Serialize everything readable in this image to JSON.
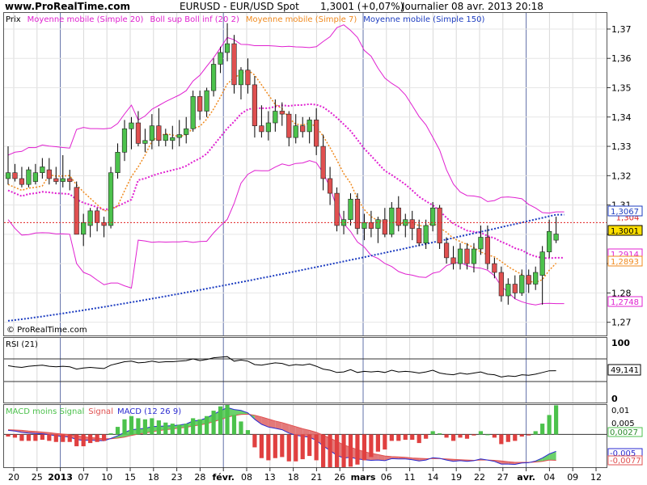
{
  "header": {
    "site": "www.ProRealTime.com",
    "instrument": "EURUSD - EUR/USD Spot",
    "last_change": "1,3001 (+0,07%)",
    "period_date": "Journalier  08 avr. 2013 20:18",
    "watermark": "© ProRealTime.com"
  },
  "colors": {
    "up": "#4cc24c",
    "down": "#e05050",
    "wick": "#000000",
    "ma20": "#e020d0",
    "boll": "#e020d0",
    "ma7": "#f08a1e",
    "ma150": "#1c3cc0",
    "price_line": "#e02020",
    "rsi": "#000000",
    "macd": "#2a2ad0",
    "signal": "#e05050",
    "hist_up": "#4cc24c",
    "hist_down": "#e04040"
  },
  "chart_data": [
    {
      "type": "candlestick",
      "title": "Prix",
      "legend": [
        {
          "label": "Prix",
          "color": "#000000"
        },
        {
          "label": "Moyenne mobile (Simple 20)",
          "color": "#e020d0"
        },
        {
          "label": "Boll sup Boll inf (20 2)",
          "color": "#e020d0"
        },
        {
          "label": "Moyenne mobile (Simple 7)",
          "color": "#f08a1e"
        },
        {
          "label": "Moyenne mobile (Simple 150)",
          "color": "#1c3cc0"
        }
      ],
      "ylim": [
        1.2655,
        1.3755
      ],
      "y_ticks": [
        1.27,
        1.28,
        1.29,
        1.3,
        1.31,
        1.32,
        1.33,
        1.34,
        1.35,
        1.36,
        1.37
      ],
      "y_tick_labels": [
        "1,27",
        "1,28",
        "",
        "",
        "1,31",
        "1,32",
        "1,33",
        "1,34",
        "1,35",
        "1,36",
        "1,37"
      ],
      "x_ticks": [
        "20",
        "25",
        "2013",
        "07",
        "10",
        "15",
        "18",
        "23",
        "28",
        "févr.",
        "08",
        "13",
        "18",
        "21",
        "26",
        "mars",
        "06",
        "11",
        "14",
        "19",
        "22",
        "27",
        "avr.",
        "04",
        "09",
        "12"
      ],
      "x_month_separators": [
        "2013",
        "févr.",
        "mars",
        "avr."
      ],
      "price_line": {
        "value": 1.304,
        "label": "1,304"
      },
      "value_labels": [
        {
          "label": "1,3067",
          "value": 1.3067,
          "series": "ma150"
        },
        {
          "label": "1,3001",
          "value": 1.3001,
          "series": "price"
        },
        {
          "label": "1,2914",
          "value": 1.2914,
          "series": "ma20"
        },
        {
          "label": "1,2893",
          "value": 1.2893,
          "series": "ma7"
        },
        {
          "label": "1,2748",
          "value": 1.2748,
          "series": "boll_inf"
        }
      ],
      "candles": [
        {
          "o": 1.319,
          "h": 1.33,
          "l": 1.317,
          "c": 1.321
        },
        {
          "o": 1.321,
          "h": 1.324,
          "l": 1.318,
          "c": 1.319
        },
        {
          "o": 1.319,
          "h": 1.323,
          "l": 1.316,
          "c": 1.317
        },
        {
          "o": 1.317,
          "h": 1.323,
          "l": 1.316,
          "c": 1.322
        },
        {
          "o": 1.318,
          "h": 1.324,
          "l": 1.317,
          "c": 1.321
        },
        {
          "o": 1.321,
          "h": 1.326,
          "l": 1.319,
          "c": 1.323
        },
        {
          "o": 1.322,
          "h": 1.326,
          "l": 1.317,
          "c": 1.319
        },
        {
          "o": 1.319,
          "h": 1.323,
          "l": 1.317,
          "c": 1.318
        },
        {
          "o": 1.318,
          "h": 1.327,
          "l": 1.316,
          "c": 1.319
        },
        {
          "o": 1.319,
          "h": 1.322,
          "l": 1.315,
          "c": 1.318
        },
        {
          "o": 1.316,
          "h": 1.318,
          "l": 1.302,
          "c": 1.3
        },
        {
          "o": 1.3,
          "h": 1.307,
          "l": 1.296,
          "c": 1.304
        },
        {
          "o": 1.303,
          "h": 1.309,
          "l": 1.299,
          "c": 1.308
        },
        {
          "o": 1.308,
          "h": 1.309,
          "l": 1.301,
          "c": 1.304
        },
        {
          "o": 1.304,
          "h": 1.306,
          "l": 1.299,
          "c": 1.303
        },
        {
          "o": 1.303,
          "h": 1.323,
          "l": 1.302,
          "c": 1.321
        },
        {
          "o": 1.321,
          "h": 1.331,
          "l": 1.319,
          "c": 1.328
        },
        {
          "o": 1.328,
          "h": 1.339,
          "l": 1.325,
          "c": 1.336
        },
        {
          "o": 1.336,
          "h": 1.34,
          "l": 1.329,
          "c": 1.338
        },
        {
          "o": 1.338,
          "h": 1.342,
          "l": 1.33,
          "c": 1.331
        },
        {
          "o": 1.331,
          "h": 1.336,
          "l": 1.328,
          "c": 1.332
        },
        {
          "o": 1.332,
          "h": 1.341,
          "l": 1.329,
          "c": 1.337
        },
        {
          "o": 1.337,
          "h": 1.343,
          "l": 1.33,
          "c": 1.332
        },
        {
          "o": 1.332,
          "h": 1.336,
          "l": 1.33,
          "c": 1.334
        },
        {
          "o": 1.332,
          "h": 1.337,
          "l": 1.329,
          "c": 1.333
        },
        {
          "o": 1.333,
          "h": 1.339,
          "l": 1.33,
          "c": 1.334
        },
        {
          "o": 1.334,
          "h": 1.34,
          "l": 1.331,
          "c": 1.336
        },
        {
          "o": 1.336,
          "h": 1.349,
          "l": 1.335,
          "c": 1.347
        },
        {
          "o": 1.347,
          "h": 1.349,
          "l": 1.339,
          "c": 1.342
        },
        {
          "o": 1.342,
          "h": 1.35,
          "l": 1.34,
          "c": 1.349
        },
        {
          "o": 1.349,
          "h": 1.36,
          "l": 1.347,
          "c": 1.358
        },
        {
          "o": 1.358,
          "h": 1.364,
          "l": 1.355,
          "c": 1.362
        },
        {
          "o": 1.362,
          "h": 1.372,
          "l": 1.359,
          "c": 1.365
        },
        {
          "o": 1.365,
          "h": 1.368,
          "l": 1.348,
          "c": 1.351
        },
        {
          "o": 1.351,
          "h": 1.357,
          "l": 1.346,
          "c": 1.356
        },
        {
          "o": 1.356,
          "h": 1.36,
          "l": 1.348,
          "c": 1.351
        },
        {
          "o": 1.351,
          "h": 1.354,
          "l": 1.333,
          "c": 1.337
        },
        {
          "o": 1.337,
          "h": 1.344,
          "l": 1.333,
          "c": 1.335
        },
        {
          "o": 1.335,
          "h": 1.342,
          "l": 1.332,
          "c": 1.338
        },
        {
          "o": 1.338,
          "h": 1.346,
          "l": 1.335,
          "c": 1.342
        },
        {
          "o": 1.342,
          "h": 1.345,
          "l": 1.337,
          "c": 1.341
        },
        {
          "o": 1.341,
          "h": 1.342,
          "l": 1.33,
          "c": 1.333
        },
        {
          "o": 1.333,
          "h": 1.341,
          "l": 1.331,
          "c": 1.337
        },
        {
          "o": 1.337,
          "h": 1.34,
          "l": 1.333,
          "c": 1.335
        },
        {
          "o": 1.335,
          "h": 1.34,
          "l": 1.331,
          "c": 1.339
        },
        {
          "o": 1.339,
          "h": 1.343,
          "l": 1.327,
          "c": 1.33
        },
        {
          "o": 1.33,
          "h": 1.334,
          "l": 1.315,
          "c": 1.319
        },
        {
          "o": 1.319,
          "h": 1.323,
          "l": 1.31,
          "c": 1.314
        },
        {
          "o": 1.314,
          "h": 1.316,
          "l": 1.301,
          "c": 1.303
        },
        {
          "o": 1.303,
          "h": 1.308,
          "l": 1.3,
          "c": 1.305
        },
        {
          "o": 1.305,
          "h": 1.314,
          "l": 1.303,
          "c": 1.312
        },
        {
          "o": 1.312,
          "h": 1.314,
          "l": 1.3,
          "c": 1.302
        },
        {
          "o": 1.302,
          "h": 1.307,
          "l": 1.298,
          "c": 1.304
        },
        {
          "o": 1.304,
          "h": 1.308,
          "l": 1.299,
          "c": 1.302
        },
        {
          "o": 1.302,
          "h": 1.306,
          "l": 1.297,
          "c": 1.305
        },
        {
          "o": 1.305,
          "h": 1.309,
          "l": 1.299,
          "c": 1.3
        },
        {
          "o": 1.3,
          "h": 1.311,
          "l": 1.299,
          "c": 1.309
        },
        {
          "o": 1.309,
          "h": 1.313,
          "l": 1.301,
          "c": 1.303
        },
        {
          "o": 1.303,
          "h": 1.307,
          "l": 1.299,
          "c": 1.305
        },
        {
          "o": 1.305,
          "h": 1.308,
          "l": 1.298,
          "c": 1.302
        },
        {
          "o": 1.302,
          "h": 1.305,
          "l": 1.296,
          "c": 1.297
        },
        {
          "o": 1.297,
          "h": 1.305,
          "l": 1.295,
          "c": 1.303
        },
        {
          "o": 1.303,
          "h": 1.311,
          "l": 1.301,
          "c": 1.309
        },
        {
          "o": 1.309,
          "h": 1.31,
          "l": 1.295,
          "c": 1.297
        },
        {
          "o": 1.297,
          "h": 1.299,
          "l": 1.29,
          "c": 1.292
        },
        {
          "o": 1.292,
          "h": 1.296,
          "l": 1.288,
          "c": 1.29
        },
        {
          "o": 1.29,
          "h": 1.297,
          "l": 1.288,
          "c": 1.295
        },
        {
          "o": 1.295,
          "h": 1.297,
          "l": 1.288,
          "c": 1.29
        },
        {
          "o": 1.29,
          "h": 1.297,
          "l": 1.287,
          "c": 1.295
        },
        {
          "o": 1.295,
          "h": 1.303,
          "l": 1.293,
          "c": 1.299
        },
        {
          "o": 1.299,
          "h": 1.303,
          "l": 1.288,
          "c": 1.29
        },
        {
          "o": 1.29,
          "h": 1.292,
          "l": 1.285,
          "c": 1.287
        },
        {
          "o": 1.287,
          "h": 1.289,
          "l": 1.277,
          "c": 1.279
        },
        {
          "o": 1.279,
          "h": 1.285,
          "l": 1.276,
          "c": 1.283
        },
        {
          "o": 1.283,
          "h": 1.286,
          "l": 1.278,
          "c": 1.28
        },
        {
          "o": 1.28,
          "h": 1.288,
          "l": 1.279,
          "c": 1.286
        },
        {
          "o": 1.286,
          "h": 1.288,
          "l": 1.28,
          "c": 1.283
        },
        {
          "o": 1.283,
          "h": 1.289,
          "l": 1.281,
          "c": 1.287
        },
        {
          "o": 1.286,
          "h": 1.296,
          "l": 1.276,
          "c": 1.294
        },
        {
          "o": 1.294,
          "h": 1.305,
          "l": 1.292,
          "c": 1.301
        },
        {
          "o": 1.298,
          "h": 1.306,
          "l": 1.297,
          "c": 1.3001
        }
      ],
      "ma20_tail": [
        1.2972,
        1.2955,
        1.294,
        1.2925,
        1.2918,
        1.2914
      ],
      "ma150_start": 1.2705,
      "ma150_end": 1.3067
    },
    {
      "type": "line",
      "title": "RSI (21)",
      "ylim": [
        0,
        100
      ],
      "y_ticks": [
        0,
        100
      ],
      "y_tick_labels": [
        "0",
        "100"
      ],
      "reference_levels": [
        70,
        30
      ],
      "last_value": {
        "label": "49,141",
        "value": 49.141
      },
      "values": [
        58,
        56,
        55,
        57,
        58,
        59,
        57,
        56,
        57,
        56,
        52,
        54,
        55,
        54,
        53,
        59,
        62,
        65,
        66,
        63,
        64,
        66,
        64,
        65,
        65,
        66,
        67,
        70,
        67,
        69,
        72,
        73,
        74,
        66,
        68,
        66,
        60,
        59,
        61,
        63,
        62,
        58,
        60,
        59,
        61,
        57,
        52,
        50,
        46,
        47,
        51,
        46,
        48,
        47,
        48,
        46,
        50,
        47,
        48,
        47,
        45,
        47,
        50,
        45,
        43,
        42,
        45,
        43,
        45,
        47,
        43,
        42,
        38,
        40,
        39,
        42,
        41,
        43,
        46,
        49,
        49.141
      ]
    },
    {
      "type": "line",
      "title": "MACD (12 26 9)",
      "legend": [
        {
          "label": "MACD moins Signal",
          "color": "#4cc24c"
        },
        {
          "label": "Signal",
          "color": "#e05050"
        },
        {
          "label": "MACD (12 26 9)",
          "color": "#2a2ad0"
        }
      ],
      "ylim": [
        -0.0095,
        0.0085
      ],
      "y_ticks": [
        0.005,
        0.01
      ],
      "y_tick_labels": [
        "0,005",
        "0,01"
      ],
      "value_labels": [
        {
          "label": "0,0027",
          "value": 0.0027,
          "series": "histogram"
        },
        {
          "label": "-0,005",
          "value": -0.005,
          "series": "macd"
        },
        {
          "label": "-0,0077",
          "value": -0.0077,
          "series": "signal"
        }
      ],
      "macd": [
        0.0012,
        0.001,
        0.0006,
        0.0004,
        0.0003,
        0.0002,
        -0.0001,
        -0.0004,
        -0.0006,
        -0.0008,
        -0.0015,
        -0.0018,
        -0.0017,
        -0.0018,
        -0.0019,
        -0.0012,
        -0.0004,
        0.0006,
        0.0014,
        0.0016,
        0.0018,
        0.0023,
        0.0024,
        0.0025,
        0.0026,
        0.0028,
        0.0031,
        0.004,
        0.0042,
        0.0049,
        0.006,
        0.007,
        0.008,
        0.0074,
        0.0071,
        0.0064,
        0.0045,
        0.003,
        0.0022,
        0.0018,
        0.0014,
        0.0004,
        -0.0002,
        -0.0006,
        -0.0008,
        -0.0018,
        -0.0034,
        -0.0048,
        -0.0062,
        -0.007,
        -0.0068,
        -0.0073,
        -0.0075,
        -0.0077,
        -0.0076,
        -0.0078,
        -0.0072,
        -0.0073,
        -0.0073,
        -0.0075,
        -0.0079,
        -0.0076,
        -0.0069,
        -0.0071,
        -0.0076,
        -0.008,
        -0.0078,
        -0.008,
        -0.0078,
        -0.0073,
        -0.0076,
        -0.008,
        -0.0088,
        -0.0088,
        -0.0089,
        -0.0085,
        -0.0084,
        -0.0079,
        -0.007,
        -0.0058,
        -0.005
      ],
      "signal": [
        0.0014,
        0.0013,
        0.0012,
        0.001,
        0.0009,
        0.0007,
        0.0005,
        0.0003,
        0.0001,
        -0.0001,
        -0.0004,
        -0.0007,
        -0.0009,
        -0.0011,
        -0.0013,
        -0.0013,
        -0.0011,
        -0.0008,
        -0.0003,
        0.0001,
        0.0004,
        0.0008,
        0.0011,
        0.0014,
        0.0016,
        0.0019,
        0.0021,
        0.0025,
        0.0028,
        0.0032,
        0.0038,
        0.0044,
        0.0051,
        0.0056,
        0.0059,
        0.006,
        0.0057,
        0.0052,
        0.0046,
        0.004,
        0.0035,
        0.0029,
        0.0023,
        0.0017,
        0.0012,
        0.0006,
        -0.0002,
        -0.0011,
        -0.0021,
        -0.0031,
        -0.0038,
        -0.0045,
        -0.0051,
        -0.0056,
        -0.006,
        -0.0064,
        -0.0066,
        -0.0067,
        -0.0068,
        -0.007,
        -0.0071,
        -0.0072,
        -0.0072,
        -0.0072,
        -0.0073,
        -0.0074,
        -0.0075,
        -0.0076,
        -0.0077,
        -0.0076,
        -0.0076,
        -0.0077,
        -0.0079,
        -0.0081,
        -0.0083,
        -0.0083,
        -0.0083,
        -0.0082,
        -0.008,
        -0.0076,
        -0.0077
      ]
    }
  ]
}
